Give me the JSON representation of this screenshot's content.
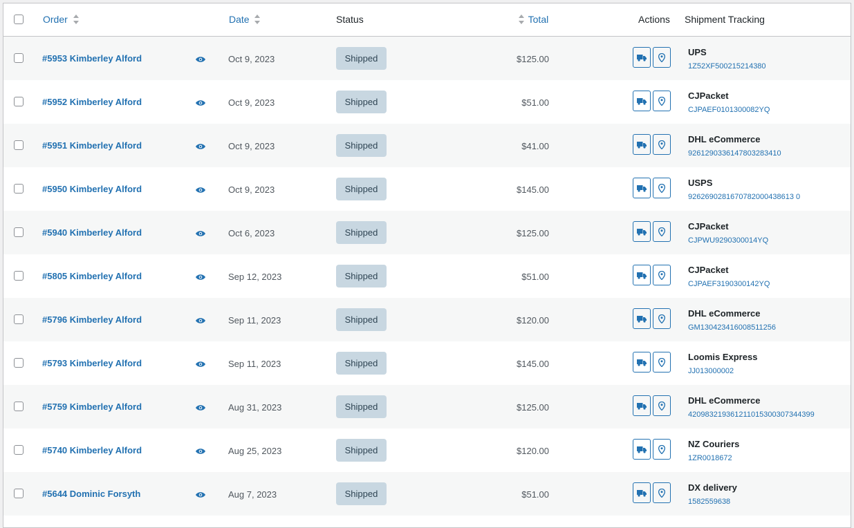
{
  "header": {
    "order_label": "Order",
    "date_label": "Date",
    "status_label": "Status",
    "total_label": "Total",
    "actions_label": "Actions",
    "tracking_label": "Shipment Tracking"
  },
  "colors": {
    "link": "#2271b1",
    "status_bg": "#c8d7e1",
    "status_text": "#2e4453",
    "alt_row": "#f6f7f7"
  },
  "icons": {
    "view": "eye-icon",
    "ship": "truck-icon",
    "track": "map-pin-icon",
    "sort": "sort-arrows-icon"
  },
  "rows": [
    {
      "order": "#5953 Kimberley Alford",
      "date": "Oct 9, 2023",
      "status": "Shipped",
      "total": "$125.00",
      "carrier": "UPS",
      "tracking": "1Z52XF500215214380"
    },
    {
      "order": "#5952 Kimberley Alford",
      "date": "Oct 9, 2023",
      "status": "Shipped",
      "total": "$51.00",
      "carrier": "CJPacket",
      "tracking": "CJPAEF0101300082YQ"
    },
    {
      "order": "#5951 Kimberley Alford",
      "date": "Oct 9, 2023",
      "status": "Shipped",
      "total": "$41.00",
      "carrier": "DHL eCommerce",
      "tracking": "9261290336147803283410"
    },
    {
      "order": "#5950 Kimberley Alford",
      "date": "Oct 9, 2023",
      "status": "Shipped",
      "total": "$145.00",
      "carrier": "USPS",
      "tracking": "9262690281670782000438613 0"
    },
    {
      "order": "#5940 Kimberley Alford",
      "date": "Oct 6, 2023",
      "status": "Shipped",
      "total": "$125.00",
      "carrier": "CJPacket",
      "tracking": "CJPWU9290300014YQ"
    },
    {
      "order": "#5805 Kimberley Alford",
      "date": "Sep 12, 2023",
      "status": "Shipped",
      "total": "$51.00",
      "carrier": "CJPacket",
      "tracking": "CJPAEF3190300142YQ"
    },
    {
      "order": "#5796 Kimberley Alford",
      "date": "Sep 11, 2023",
      "status": "Shipped",
      "total": "$120.00",
      "carrier": "DHL eCommerce",
      "tracking": "GM130423416008511256"
    },
    {
      "order": "#5793 Kimberley Alford",
      "date": "Sep 11, 2023",
      "status": "Shipped",
      "total": "$145.00",
      "carrier": "Loomis Express",
      "tracking": "JJ013000002"
    },
    {
      "order": "#5759 Kimberley Alford",
      "date": "Aug 31, 2023",
      "status": "Shipped",
      "total": "$125.00",
      "carrier": "DHL eCommerce",
      "tracking": "420983219361211015300307344399"
    },
    {
      "order": "#5740 Kimberley Alford",
      "date": "Aug 25, 2023",
      "status": "Shipped",
      "total": "$120.00",
      "carrier": "NZ Couriers",
      "tracking": "1ZR0018672"
    },
    {
      "order": "#5644 Dominic Forsyth",
      "date": "Aug 7, 2023",
      "status": "Shipped",
      "total": "$51.00",
      "carrier": "DX delivery",
      "tracking": "1582559638"
    }
  ]
}
